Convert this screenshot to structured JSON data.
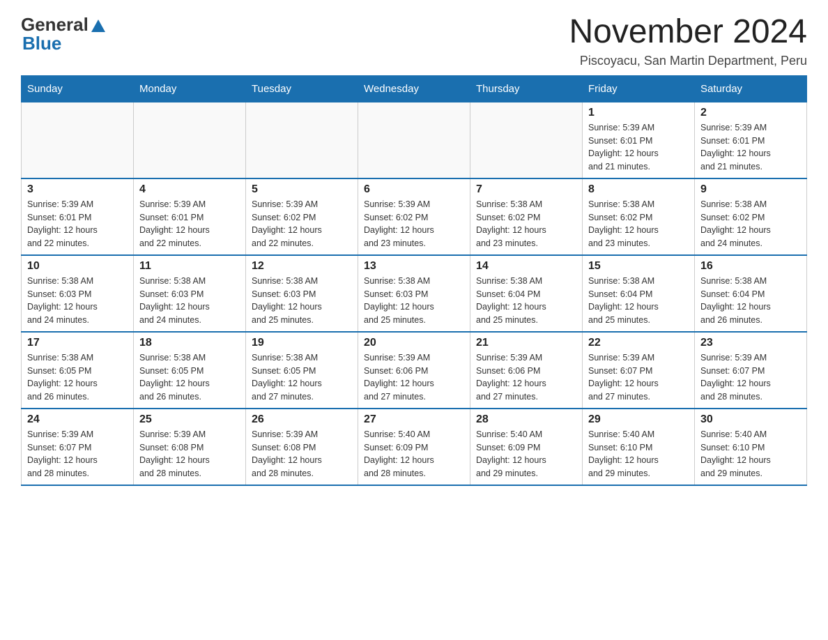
{
  "header": {
    "logo_general": "General",
    "logo_blue": "Blue",
    "month_title": "November 2024",
    "location": "Piscoyacu, San Martin Department, Peru"
  },
  "weekdays": [
    "Sunday",
    "Monday",
    "Tuesday",
    "Wednesday",
    "Thursday",
    "Friday",
    "Saturday"
  ],
  "weeks": [
    [
      {
        "day": "",
        "info": ""
      },
      {
        "day": "",
        "info": ""
      },
      {
        "day": "",
        "info": ""
      },
      {
        "day": "",
        "info": ""
      },
      {
        "day": "",
        "info": ""
      },
      {
        "day": "1",
        "info": "Sunrise: 5:39 AM\nSunset: 6:01 PM\nDaylight: 12 hours\nand 21 minutes."
      },
      {
        "day": "2",
        "info": "Sunrise: 5:39 AM\nSunset: 6:01 PM\nDaylight: 12 hours\nand 21 minutes."
      }
    ],
    [
      {
        "day": "3",
        "info": "Sunrise: 5:39 AM\nSunset: 6:01 PM\nDaylight: 12 hours\nand 22 minutes."
      },
      {
        "day": "4",
        "info": "Sunrise: 5:39 AM\nSunset: 6:01 PM\nDaylight: 12 hours\nand 22 minutes."
      },
      {
        "day": "5",
        "info": "Sunrise: 5:39 AM\nSunset: 6:02 PM\nDaylight: 12 hours\nand 22 minutes."
      },
      {
        "day": "6",
        "info": "Sunrise: 5:39 AM\nSunset: 6:02 PM\nDaylight: 12 hours\nand 23 minutes."
      },
      {
        "day": "7",
        "info": "Sunrise: 5:38 AM\nSunset: 6:02 PM\nDaylight: 12 hours\nand 23 minutes."
      },
      {
        "day": "8",
        "info": "Sunrise: 5:38 AM\nSunset: 6:02 PM\nDaylight: 12 hours\nand 23 minutes."
      },
      {
        "day": "9",
        "info": "Sunrise: 5:38 AM\nSunset: 6:02 PM\nDaylight: 12 hours\nand 24 minutes."
      }
    ],
    [
      {
        "day": "10",
        "info": "Sunrise: 5:38 AM\nSunset: 6:03 PM\nDaylight: 12 hours\nand 24 minutes."
      },
      {
        "day": "11",
        "info": "Sunrise: 5:38 AM\nSunset: 6:03 PM\nDaylight: 12 hours\nand 24 minutes."
      },
      {
        "day": "12",
        "info": "Sunrise: 5:38 AM\nSunset: 6:03 PM\nDaylight: 12 hours\nand 25 minutes."
      },
      {
        "day": "13",
        "info": "Sunrise: 5:38 AM\nSunset: 6:03 PM\nDaylight: 12 hours\nand 25 minutes."
      },
      {
        "day": "14",
        "info": "Sunrise: 5:38 AM\nSunset: 6:04 PM\nDaylight: 12 hours\nand 25 minutes."
      },
      {
        "day": "15",
        "info": "Sunrise: 5:38 AM\nSunset: 6:04 PM\nDaylight: 12 hours\nand 25 minutes."
      },
      {
        "day": "16",
        "info": "Sunrise: 5:38 AM\nSunset: 6:04 PM\nDaylight: 12 hours\nand 26 minutes."
      }
    ],
    [
      {
        "day": "17",
        "info": "Sunrise: 5:38 AM\nSunset: 6:05 PM\nDaylight: 12 hours\nand 26 minutes."
      },
      {
        "day": "18",
        "info": "Sunrise: 5:38 AM\nSunset: 6:05 PM\nDaylight: 12 hours\nand 26 minutes."
      },
      {
        "day": "19",
        "info": "Sunrise: 5:38 AM\nSunset: 6:05 PM\nDaylight: 12 hours\nand 27 minutes."
      },
      {
        "day": "20",
        "info": "Sunrise: 5:39 AM\nSunset: 6:06 PM\nDaylight: 12 hours\nand 27 minutes."
      },
      {
        "day": "21",
        "info": "Sunrise: 5:39 AM\nSunset: 6:06 PM\nDaylight: 12 hours\nand 27 minutes."
      },
      {
        "day": "22",
        "info": "Sunrise: 5:39 AM\nSunset: 6:07 PM\nDaylight: 12 hours\nand 27 minutes."
      },
      {
        "day": "23",
        "info": "Sunrise: 5:39 AM\nSunset: 6:07 PM\nDaylight: 12 hours\nand 28 minutes."
      }
    ],
    [
      {
        "day": "24",
        "info": "Sunrise: 5:39 AM\nSunset: 6:07 PM\nDaylight: 12 hours\nand 28 minutes."
      },
      {
        "day": "25",
        "info": "Sunrise: 5:39 AM\nSunset: 6:08 PM\nDaylight: 12 hours\nand 28 minutes."
      },
      {
        "day": "26",
        "info": "Sunrise: 5:39 AM\nSunset: 6:08 PM\nDaylight: 12 hours\nand 28 minutes."
      },
      {
        "day": "27",
        "info": "Sunrise: 5:40 AM\nSunset: 6:09 PM\nDaylight: 12 hours\nand 28 minutes."
      },
      {
        "day": "28",
        "info": "Sunrise: 5:40 AM\nSunset: 6:09 PM\nDaylight: 12 hours\nand 29 minutes."
      },
      {
        "day": "29",
        "info": "Sunrise: 5:40 AM\nSunset: 6:10 PM\nDaylight: 12 hours\nand 29 minutes."
      },
      {
        "day": "30",
        "info": "Sunrise: 5:40 AM\nSunset: 6:10 PM\nDaylight: 12 hours\nand 29 minutes."
      }
    ]
  ]
}
